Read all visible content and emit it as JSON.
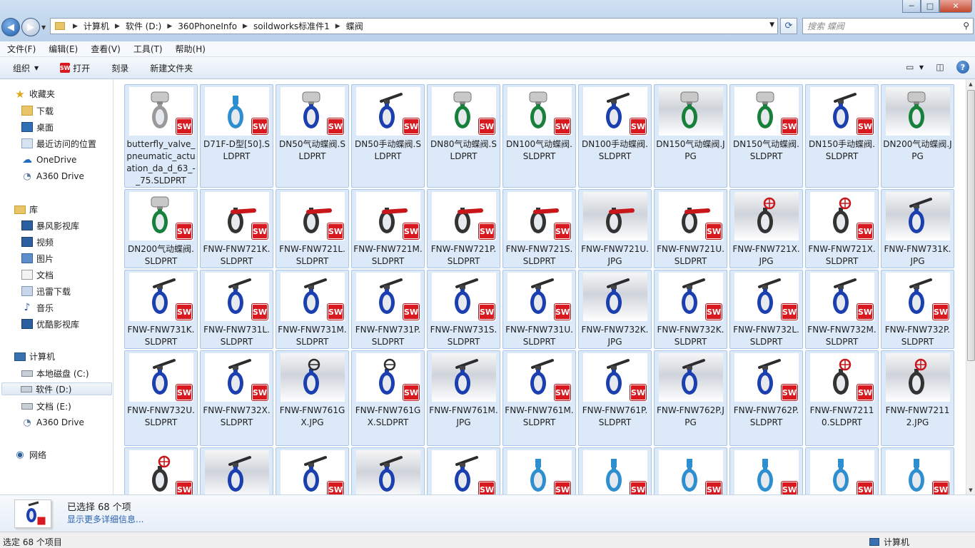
{
  "window": {
    "caption_min": "─",
    "caption_max": "□",
    "caption_close": "✕"
  },
  "address": {
    "breadcrumbs": [
      "计算机",
      "软件 (D:)",
      "360PhoneInfo",
      "soildworks标准件1",
      "蝶阀"
    ]
  },
  "search": {
    "placeholder": "搜索 蝶阀"
  },
  "menu": [
    "文件(F)",
    "编辑(E)",
    "查看(V)",
    "工具(T)",
    "帮助(H)"
  ],
  "toolbar": {
    "organize": "组织",
    "open": "打开",
    "burn": "刻录",
    "new_folder": "新建文件夹"
  },
  "nav": {
    "favorites": "收藏夹",
    "favorites_items": [
      "下载",
      "桌面",
      "最近访问的位置",
      "OneDrive",
      "A360 Drive"
    ],
    "libraries": "库",
    "library_items": [
      "暴风影视库",
      "视频",
      "图片",
      "文档",
      "迅雷下载",
      "音乐",
      "优酷影视库"
    ],
    "computer": "计算机",
    "computer_items": [
      "本地磁盘 (C:)",
      "软件 (D:)",
      "文档 (E:)",
      "A360 Drive"
    ],
    "network": "网络"
  },
  "files": [
    {
      "name": "butterfly_valve_pneumatic_actuation_da_d_63_-_75.SLDPRT",
      "type": "sldprt",
      "color": "#9a9a9a",
      "style": "actuator"
    },
    {
      "name": "D71F-D型[50].SLDPRT",
      "type": "sldprt",
      "color": "#2e8fd0",
      "style": "plain"
    },
    {
      "name": "DN50气动蝶阀.SLDPRT",
      "type": "sldprt",
      "color": "#1c3fb0",
      "style": "actuator"
    },
    {
      "name": "DN50手动蝶阀.SLDPRT",
      "type": "sldprt",
      "color": "#1c3fb0",
      "style": "lever"
    },
    {
      "name": "DN80气动蝶阀.SLDPRT",
      "type": "sldprt",
      "color": "#17803a",
      "style": "actuator"
    },
    {
      "name": "DN100气动蝶阀.SLDPRT",
      "type": "sldprt",
      "color": "#17803a",
      "style": "actuator"
    },
    {
      "name": "DN100手动蝶阀.SLDPRT",
      "type": "sldprt",
      "color": "#1c3fb0",
      "style": "lever"
    },
    {
      "name": "DN150气动蝶阀.JPG",
      "type": "jpg",
      "color": "#17803a",
      "style": "actuator"
    },
    {
      "name": "DN150气动蝶阀.SLDPRT",
      "type": "sldprt",
      "color": "#17803a",
      "style": "actuator"
    },
    {
      "name": "DN150手动蝶阀.SLDPRT",
      "type": "sldprt",
      "color": "#1c3fb0",
      "style": "lever"
    },
    {
      "name": "DN200气动蝶阀.JPG",
      "type": "jpg",
      "color": "#17803a",
      "style": "actuator"
    },
    {
      "name": "DN200气动蝶阀.SLDPRT",
      "type": "sldprt",
      "color": "#17803a",
      "style": "actuator"
    },
    {
      "name": "FNW-FNW721K.SLDPRT",
      "type": "sldprt",
      "color": "#333333",
      "style": "red-lever"
    },
    {
      "name": "FNW-FNW721L.SLDPRT",
      "type": "sldprt",
      "color": "#333333",
      "style": "red-lever"
    },
    {
      "name": "FNW-FNW721M.SLDPRT",
      "type": "sldprt",
      "color": "#333333",
      "style": "red-lever"
    },
    {
      "name": "FNW-FNW721P.SLDPRT",
      "type": "sldprt",
      "color": "#333333",
      "style": "red-lever"
    },
    {
      "name": "FNW-FNW721S.SLDPRT",
      "type": "sldprt",
      "color": "#333333",
      "style": "red-lever"
    },
    {
      "name": "FNW-FNW721U.JPG",
      "type": "jpg",
      "color": "#333333",
      "style": "red-lever"
    },
    {
      "name": "FNW-FNW721U.SLDPRT",
      "type": "sldprt",
      "color": "#333333",
      "style": "red-lever"
    },
    {
      "name": "FNW-FNW721X.JPG",
      "type": "jpg",
      "color": "#333333",
      "style": "red-wheel"
    },
    {
      "name": "FNW-FNW721X.SLDPRT",
      "type": "sldprt",
      "color": "#333333",
      "style": "red-wheel"
    },
    {
      "name": "FNW-FNW731K.JPG",
      "type": "jpg",
      "color": "#1c3fb0",
      "style": "lever"
    },
    {
      "name": "FNW-FNW731K.SLDPRT",
      "type": "sldprt",
      "color": "#1c3fb0",
      "style": "lever"
    },
    {
      "name": "FNW-FNW731L.SLDPRT",
      "type": "sldprt",
      "color": "#1c3fb0",
      "style": "lever"
    },
    {
      "name": "FNW-FNW731M.SLDPRT",
      "type": "sldprt",
      "color": "#1c3fb0",
      "style": "lever"
    },
    {
      "name": "FNW-FNW731P.SLDPRT",
      "type": "sldprt",
      "color": "#1c3fb0",
      "style": "lever"
    },
    {
      "name": "FNW-FNW731S.SLDPRT",
      "type": "sldprt",
      "color": "#1c3fb0",
      "style": "lever"
    },
    {
      "name": "FNW-FNW731U.SLDPRT",
      "type": "sldprt",
      "color": "#1c3fb0",
      "style": "lever"
    },
    {
      "name": "FNW-FNW732K.JPG",
      "type": "jpg",
      "color": "#1c3fb0",
      "style": "lever"
    },
    {
      "name": "FNW-FNW732K.SLDPRT",
      "type": "sldprt",
      "color": "#1c3fb0",
      "style": "lever"
    },
    {
      "name": "FNW-FNW732L.SLDPRT",
      "type": "sldprt",
      "color": "#1c3fb0",
      "style": "lever"
    },
    {
      "name": "FNW-FNW732M.SLDPRT",
      "type": "sldprt",
      "color": "#1c3fb0",
      "style": "lever"
    },
    {
      "name": "FNW-FNW732P.SLDPRT",
      "type": "sldprt",
      "color": "#1c3fb0",
      "style": "lever"
    },
    {
      "name": "FNW-FNW732U.SLDPRT",
      "type": "sldprt",
      "color": "#1c3fb0",
      "style": "lever"
    },
    {
      "name": "FNW-FNW732X.SLDPRT",
      "type": "sldprt",
      "color": "#1c3fb0",
      "style": "lever"
    },
    {
      "name": "FNW-FNW761GX.JPG",
      "type": "jpg",
      "color": "#1c3fb0",
      "style": "wheel"
    },
    {
      "name": "FNW-FNW761GX.SLDPRT",
      "type": "sldprt",
      "color": "#1c3fb0",
      "style": "wheel"
    },
    {
      "name": "FNW-FNW761M.JPG",
      "type": "jpg",
      "color": "#1c3fb0",
      "style": "lever"
    },
    {
      "name": "FNW-FNW761M.SLDPRT",
      "type": "sldprt",
      "color": "#1c3fb0",
      "style": "lever"
    },
    {
      "name": "FNW-FNW761P.SLDPRT",
      "type": "sldprt",
      "color": "#1c3fb0",
      "style": "lever"
    },
    {
      "name": "FNW-FNW762P.JPG",
      "type": "jpg",
      "color": "#1c3fb0",
      "style": "lever"
    },
    {
      "name": "FNW-FNW762P.SLDPRT",
      "type": "sldprt",
      "color": "#1c3fb0",
      "style": "lever"
    },
    {
      "name": "FNW-FNW72110.SLDPRT",
      "type": "sldprt",
      "color": "#333333",
      "style": "red-wheel"
    },
    {
      "name": "FNW-FNW72112.JPG",
      "type": "jpg",
      "color": "#333333",
      "style": "red-wheel"
    },
    {
      "name": "",
      "type": "sldprt",
      "color": "#333333",
      "style": "red-wheel"
    },
    {
      "name": "",
      "type": "jpg",
      "color": "#1c3fb0",
      "style": "lever"
    },
    {
      "name": "",
      "type": "sldprt",
      "color": "#1c3fb0",
      "style": "lever"
    },
    {
      "name": "",
      "type": "jpg",
      "color": "#1c3fb0",
      "style": "lever"
    },
    {
      "name": "",
      "type": "sldprt",
      "color": "#1c3fb0",
      "style": "lever"
    },
    {
      "name": "",
      "type": "sldprt",
      "color": "#2e8fd0",
      "style": "plain"
    },
    {
      "name": "",
      "type": "sldprt",
      "color": "#2e8fd0",
      "style": "plain"
    },
    {
      "name": "",
      "type": "sldprt",
      "color": "#2e8fd0",
      "style": "plain"
    },
    {
      "name": "",
      "type": "sldprt",
      "color": "#2e8fd0",
      "style": "plain"
    },
    {
      "name": "",
      "type": "sldprt",
      "color": "#2e8fd0",
      "style": "plain"
    },
    {
      "name": "",
      "type": "sldprt",
      "color": "#2e8fd0",
      "style": "plain"
    }
  ],
  "sw_badge": "SW",
  "details": {
    "selected": "已选择 68 个项",
    "more": "显示更多详细信息..."
  },
  "status": {
    "left": "选定 68 个项目",
    "right": "计算机"
  }
}
